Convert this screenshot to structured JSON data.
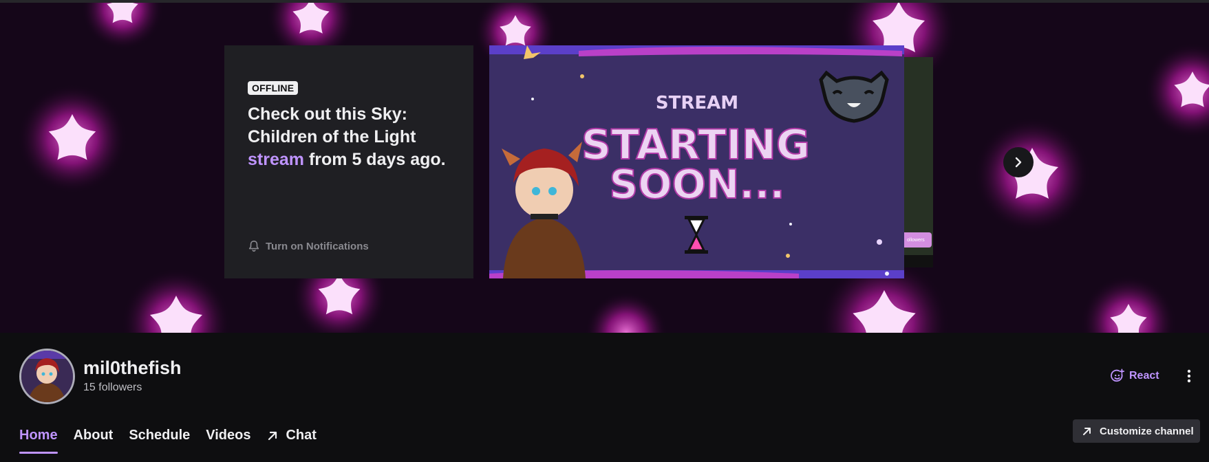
{
  "banner": {
    "offline_badge": "OFFLINE",
    "title_part1": "Check out this Sky: Children of the Light",
    "title_link": "stream",
    "title_part2": "from 5 days ago.",
    "notifications_label": "Turn on Notifications",
    "preview": {
      "line1": "STREAM",
      "line2": "STARTING",
      "line3": "SOON..."
    },
    "next_preview_pill": "ollowers"
  },
  "channel": {
    "name": "mil0thefish",
    "followers": "15 followers",
    "react_label": "React"
  },
  "tabs": [
    {
      "label": "Home",
      "active": true
    },
    {
      "label": "About",
      "active": false
    },
    {
      "label": "Schedule",
      "active": false
    },
    {
      "label": "Videos",
      "active": false
    },
    {
      "label": "Chat",
      "active": false
    }
  ],
  "customize_label": "Customize channel",
  "colors": {
    "accent": "#bf94ff",
    "background": "#0e0e10",
    "card": "#1f1f23",
    "star_glow": "#e040c8"
  }
}
